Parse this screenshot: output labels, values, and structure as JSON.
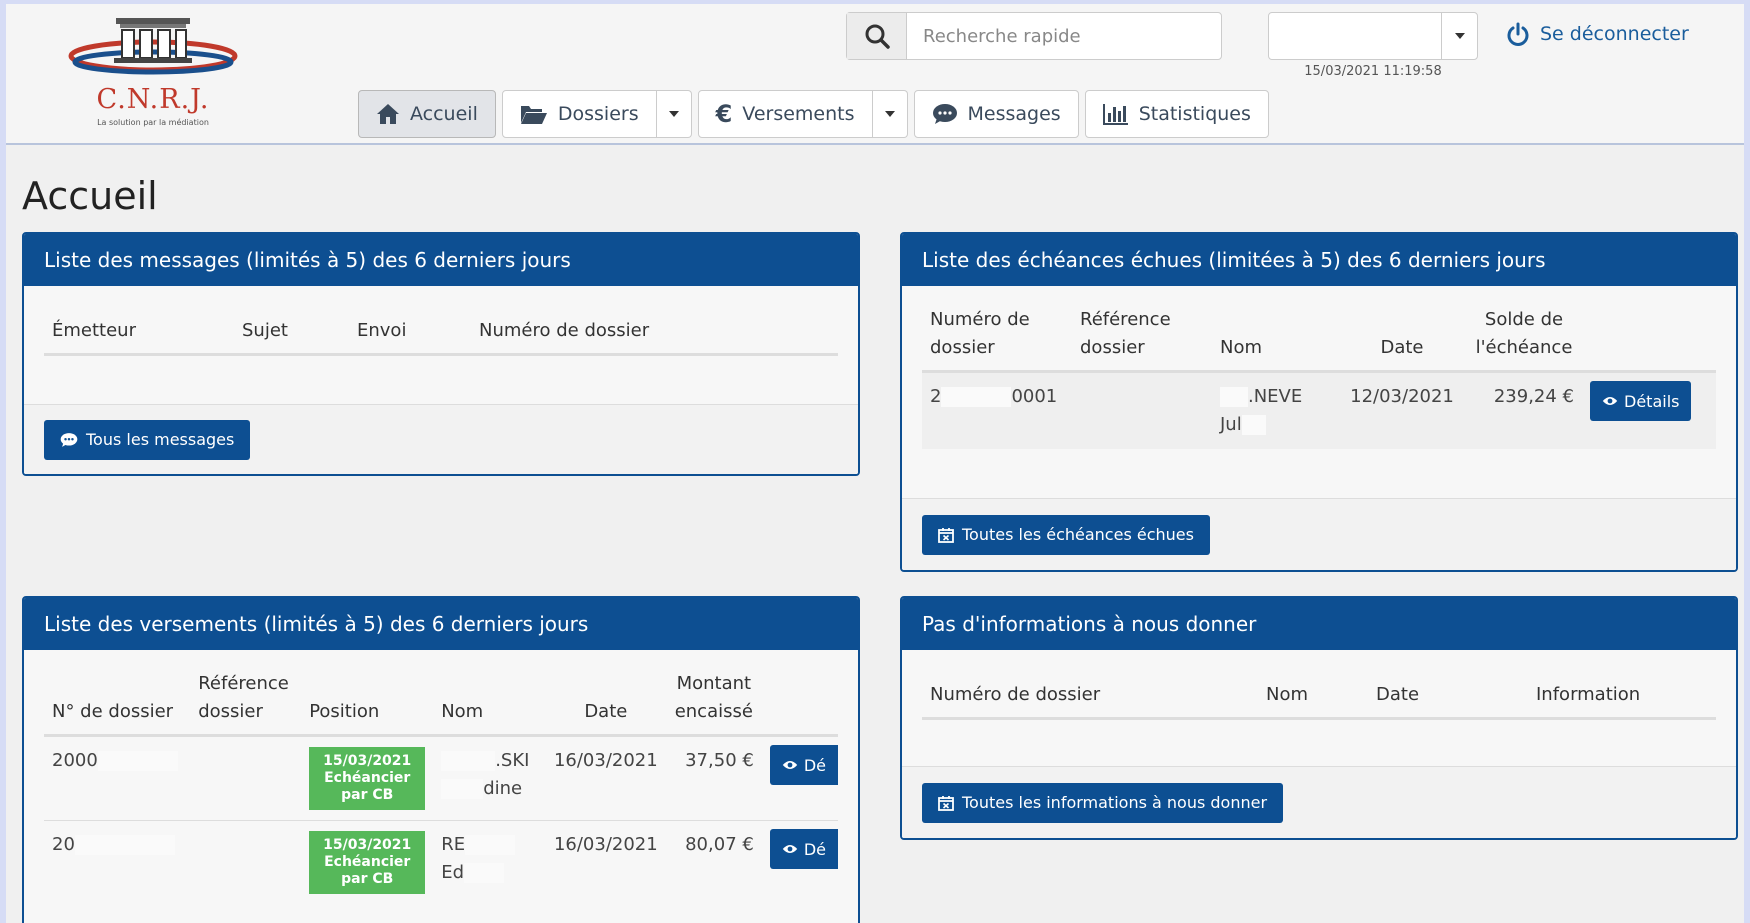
{
  "header": {
    "logo_title": "C.N.R.J.",
    "logo_tagline": "La solution par la médiation",
    "search_placeholder": "Recherche rapide",
    "datetime": "15/03/2021 11:19:58",
    "logout_label": "Se déconnecter"
  },
  "nav": {
    "home": "Accueil",
    "dossiers": "Dossiers",
    "versements": "Versements",
    "messages": "Messages",
    "statistiques": "Statistiques"
  },
  "page_title": "Accueil",
  "messages_panel": {
    "title": "Liste des messages (limités à 5) des 6 derniers jours",
    "columns": [
      "Émetteur",
      "Sujet",
      "Envoi",
      "Numéro de dossier"
    ],
    "button": "Tous les messages"
  },
  "echeances_panel": {
    "title": "Liste des échéances échues (limitées à 5) des 6 derniers jours",
    "columns": [
      "Numéro de dossier",
      "Référence dossier",
      "Nom",
      "Date",
      "Solde de l'échéance"
    ],
    "rows": [
      {
        "numero_a": "2",
        "numero_b": "0001",
        "reference": "",
        "nom_a": ".NEVE",
        "nom_b": "Jul",
        "date": "12/03/2021",
        "solde": "239,24 €",
        "action": "Détails"
      }
    ],
    "button": "Toutes les échéances échues"
  },
  "versements_panel": {
    "title": "Liste des versements (limités à 5) des 6 derniers jours",
    "columns": [
      "N° de dossier",
      "Référence dossier",
      "Position",
      "Nom",
      "Date",
      "Montant encaissé"
    ],
    "rows": [
      {
        "dossier": "2000",
        "reference": "",
        "position_date": "15/03/2021",
        "position_text": "Echéancier par CB",
        "nom_a": ".SKI",
        "nom_b": "dine",
        "date": "16/03/2021",
        "montant": "37,50 €",
        "action": "Dé"
      },
      {
        "dossier": "20",
        "reference": "",
        "position_date": "15/03/2021",
        "position_text": "Echéancier par CB",
        "nom_a": "RE",
        "nom_b": "Ed",
        "date": "16/03/2021",
        "montant": "80,07 €",
        "action": "Dé"
      }
    ]
  },
  "infos_panel": {
    "title": "Pas d'informations à nous donner",
    "columns": [
      "Numéro de dossier",
      "Nom",
      "Date",
      "Information"
    ],
    "button": "Toutes les informations à nous donner"
  },
  "colors": {
    "primary": "#0d4f92",
    "badge_green": "#56b85a",
    "logout_blue": "#1a5d9c"
  }
}
